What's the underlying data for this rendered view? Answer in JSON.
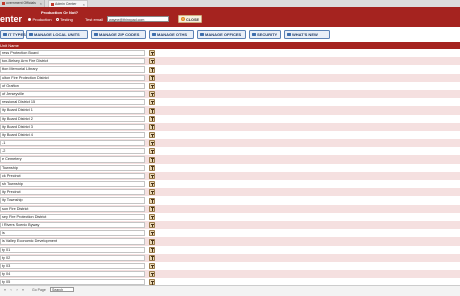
{
  "browser": {
    "tabs": [
      {
        "label": "overnment Officials"
      },
      {
        "label": "Admin Center"
      }
    ],
    "close_glyph": "×"
  },
  "header": {
    "title": "enter",
    "production_label": "Production Or Not?",
    "radio_options": [
      {
        "label": "Production",
        "selected": true
      },
      {
        "label": "Testing",
        "selected": false
      }
    ],
    "email_label": "Test email",
    "email_value": "wayne@thinxpad.com",
    "close_label": "CLOSE",
    "accent_color": "#a5231f"
  },
  "nav": {
    "buttons": [
      {
        "label": "IT TYPES",
        "icon": "list-icon"
      },
      {
        "label": "MANAGE LOCAL UNITS",
        "icon": "building-icon"
      },
      {
        "label": "MANAGE ZIP CODES",
        "icon": "map-icon"
      },
      {
        "label": "MANAGE OTHS",
        "icon": "document-icon"
      },
      {
        "label": "MANAGE OFFICES",
        "icon": "office-icon"
      },
      {
        "label": "SECURITY",
        "icon": "lock-icon"
      },
      {
        "label": "WHAT'S NEW",
        "icon": "news-icon"
      }
    ]
  },
  "table": {
    "column_header": "Unit Name",
    "rows": [
      "ress Protection Board",
      "ton-Belsey Arm Fire District",
      "tton Memorial Library",
      "ulton Fire Protection District",
      "of Grafton",
      "of Jerseyville",
      "ressional District 15",
      "ity Board District 1",
      "ity Board District 2",
      "ity Board District 3",
      "ity Board District 4",
      "-1",
      "-2",
      "e Cemetery",
      "Township",
      "ck Precinct",
      "sh Township",
      "ity Precinct",
      "ity Township",
      "son Fire District",
      "sey Fire Protection District",
      "l Rivers Scenic Byway",
      "is",
      "is Valley Economic Development",
      "ty 01",
      "ty 02",
      "ty 03",
      "ty 04",
      "ty 05"
    ]
  },
  "footer": {
    "first": "«",
    "prev": "‹",
    "next": "›",
    "last": "»",
    "page_info": "Go Page",
    "search_placeholder": "Search"
  }
}
